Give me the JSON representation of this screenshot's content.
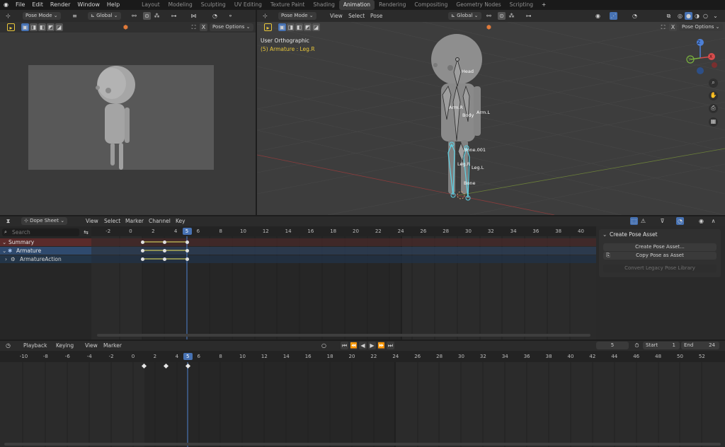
{
  "menus": [
    "File",
    "Edit",
    "Render",
    "Window",
    "Help"
  ],
  "workspaces": [
    "Layout",
    "Modeling",
    "Sculpting",
    "UV Editing",
    "Texture Paint",
    "Shading",
    "Animation",
    "Rendering",
    "Compositing",
    "Geometry Nodes",
    "Scripting"
  ],
  "active_workspace": "Animation",
  "left_view": {
    "mode": "Pose Mode",
    "orientation": "Global",
    "options": "Pose Options"
  },
  "main_view": {
    "mode": "Pose Mode",
    "menus": [
      "View",
      "Select",
      "Pose"
    ],
    "orientation": "Global",
    "options": "Pose Options",
    "overlay_title": "User Orthographic",
    "overlay_sub": "(5) Armature : Leg.R",
    "bones": [
      "Head",
      "Arm.R",
      "Arm.L",
      "Body",
      "Bone.001",
      "Leg.R",
      "Leg.L",
      "Bone"
    ],
    "gizmo_axes": [
      "Y",
      "X",
      "Z"
    ]
  },
  "dopesheet": {
    "mode": "Dope Sheet",
    "menus": [
      "View",
      "Select",
      "Marker",
      "Channel",
      "Key"
    ],
    "search_placeholder": "Search",
    "ticks": [
      "-2",
      "0",
      "2",
      "4",
      "5",
      "6",
      "8",
      "10",
      "12",
      "14",
      "16",
      "18",
      "20",
      "22",
      "24",
      "26",
      "28",
      "30",
      "32",
      "34",
      "36",
      "38",
      "40"
    ],
    "current_frame": "5",
    "channels": [
      "Summary",
      "Armature",
      "ArmatureAction"
    ],
    "panel_title": "Create Pose Asset",
    "panel_buttons": [
      "Create Pose Asset...",
      "Copy Pose as Asset",
      "Convert Legacy Pose Library"
    ]
  },
  "timeline": {
    "menus": [
      "Playback",
      "Keying",
      "View",
      "Marker"
    ],
    "frame": "5",
    "start_label": "Start",
    "start": "1",
    "end_label": "End",
    "end": "24",
    "ticks": [
      "-10",
      "-8",
      "-6",
      "-4",
      "-2",
      "0",
      "2",
      "4",
      "5",
      "6",
      "8",
      "10",
      "12",
      "14",
      "16",
      "18",
      "20",
      "22",
      "24",
      "26",
      "28",
      "30",
      "32",
      "34",
      "36",
      "38",
      "40",
      "42",
      "44",
      "46",
      "48",
      "50",
      "52"
    ]
  },
  "colors": {
    "accent": "#4772b3",
    "summary_row": "#5a2b2b",
    "object_row": "#2f4a6e",
    "action_row": "#233548",
    "bone_select": "#5fd3e6",
    "overlay_sub": "#e8c63a"
  }
}
